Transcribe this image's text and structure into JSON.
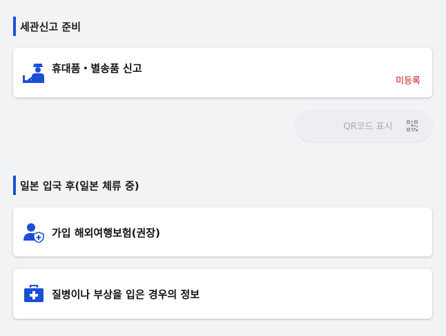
{
  "sections": [
    {
      "title": "세관신고 준비",
      "cards": [
        {
          "icon": "customs-officer-icon",
          "label": "휴대품・별송품 신고",
          "status": "미등록"
        }
      ],
      "qr_button": {
        "label": "QR코드 표시",
        "icon": "qr-code-icon"
      }
    },
    {
      "title": "일본 입국 후(일본 체류 중)",
      "cards": [
        {
          "icon": "user-shield-icon",
          "label": "가입 해외여행보험(권장)"
        },
        {
          "icon": "medical-kit-icon",
          "label": "질병이나 부상을 입은 경우의 정보"
        }
      ]
    }
  ],
  "colors": {
    "accent": "#1a4fd6",
    "status_unregistered": "#c01a1a",
    "disabled_text": "#a8abb0",
    "background": "#f2f3f5"
  }
}
